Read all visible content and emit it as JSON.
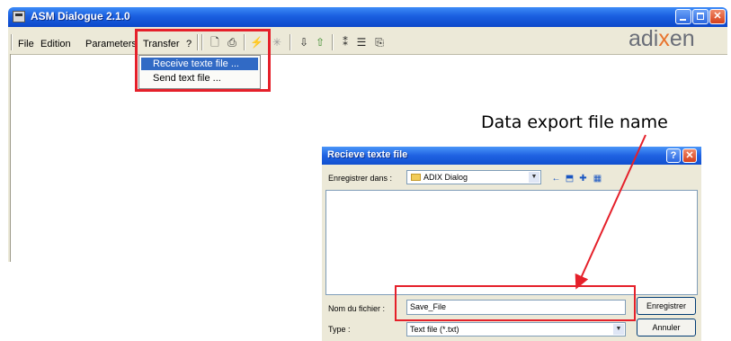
{
  "window": {
    "title": "ASM Dialogue 2.1.0",
    "logo_prefix": "adi",
    "logo_x": "x",
    "logo_suffix": "en"
  },
  "menu": {
    "file": "File",
    "edition": "Edition",
    "parameters": "Parameters",
    "transfer": "Transfer",
    "help": "?"
  },
  "transfer_menu": {
    "items": [
      "Receive texte file ...",
      "Send text file ..."
    ]
  },
  "annotation": "Data export file name",
  "dialog": {
    "title": "Recieve texte file",
    "save_in_label": "Enregistrer dans :",
    "save_in_value": "ADIX Dialog",
    "filename_label": "Nom du fichier :",
    "filename_value": "Save_File",
    "type_label": "Type :",
    "type_value": "Text file (*.txt)",
    "save_button": "Enregistrer",
    "cancel_button": "Annuler"
  },
  "colors": {
    "highlight_red": "#e5202a",
    "titlebar_blue": "#1a5fe0",
    "logo_orange": "#e8732d"
  }
}
